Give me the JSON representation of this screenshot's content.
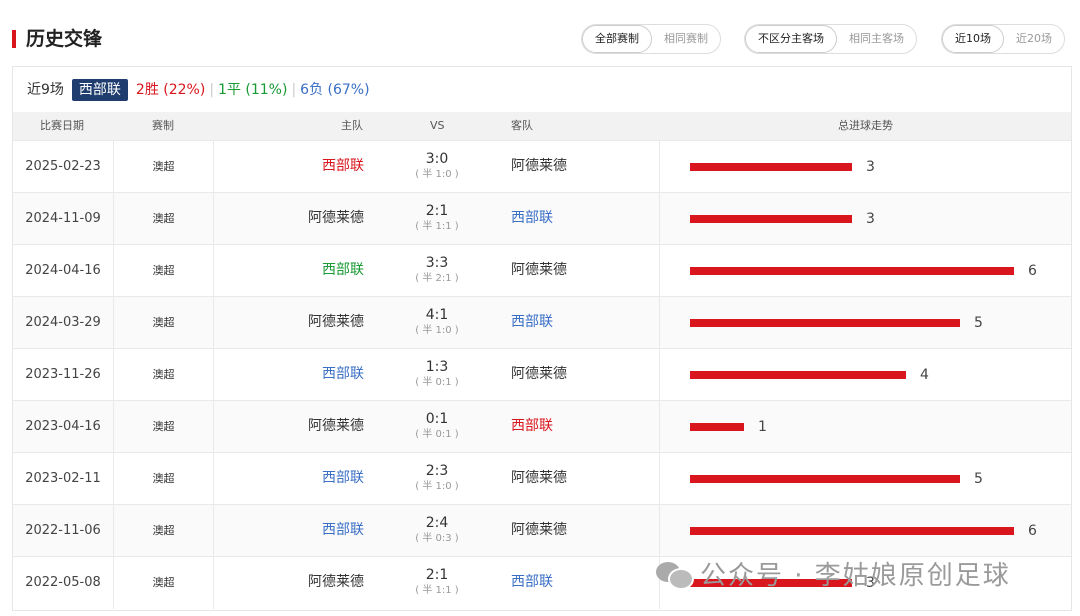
{
  "header": {
    "title": "历史交锋",
    "filter_groups": [
      {
        "options": [
          "全部赛制",
          "相同赛制"
        ],
        "selected": 0
      },
      {
        "options": [
          "不区分主客场",
          "相同主客场"
        ],
        "selected": 0
      },
      {
        "options": [
          "近10场",
          "近20场"
        ],
        "selected": 0
      }
    ]
  },
  "summary": {
    "recent_label": "近9场",
    "team": "西部联",
    "wins": "2胜 (22%)",
    "draws": "1平 (11%)",
    "losses": "6负 (67%)",
    "separator": "|"
  },
  "table": {
    "columns": [
      "比赛日期",
      "赛制",
      "主队",
      "VS",
      "客队",
      "总进球走势"
    ],
    "rows": [
      {
        "date": "2025-02-23",
        "competition": "澳超",
        "home": "西部联",
        "home_color": "#d9161e",
        "score": "3:0",
        "halftime": "( 半 1:0 )",
        "away": "阿德莱德",
        "away_color": "#333333",
        "total_goals": 3
      },
      {
        "date": "2024-11-09",
        "competition": "澳超",
        "home": "阿德莱德",
        "home_color": "#333333",
        "score": "2:1",
        "halftime": "( 半 1:1 )",
        "away": "西部联",
        "away_color": "#3a6fc5",
        "total_goals": 3
      },
      {
        "date": "2024-04-16",
        "competition": "澳超",
        "home": "西部联",
        "home_color": "#189a34",
        "score": "3:3",
        "halftime": "( 半 2:1 )",
        "away": "阿德莱德",
        "away_color": "#333333",
        "total_goals": 6
      },
      {
        "date": "2024-03-29",
        "competition": "澳超",
        "home": "阿德莱德",
        "home_color": "#333333",
        "score": "4:1",
        "halftime": "( 半 1:0 )",
        "away": "西部联",
        "away_color": "#3a6fc5",
        "total_goals": 5
      },
      {
        "date": "2023-11-26",
        "competition": "澳超",
        "home": "西部联",
        "home_color": "#3a6fc5",
        "score": "1:3",
        "halftime": "( 半 0:1 )",
        "away": "阿德莱德",
        "away_color": "#333333",
        "total_goals": 4
      },
      {
        "date": "2023-04-16",
        "competition": "澳超",
        "home": "阿德莱德",
        "home_color": "#333333",
        "score": "0:1",
        "halftime": "( 半 0:1 )",
        "away": "西部联",
        "away_color": "#d9161e",
        "total_goals": 1
      },
      {
        "date": "2023-02-11",
        "competition": "澳超",
        "home": "西部联",
        "home_color": "#3a6fc5",
        "score": "2:3",
        "halftime": "( 半 1:0 )",
        "away": "阿德莱德",
        "away_color": "#333333",
        "total_goals": 5
      },
      {
        "date": "2022-11-06",
        "competition": "澳超",
        "home": "西部联",
        "home_color": "#3a6fc5",
        "score": "2:4",
        "halftime": "( 半 0:3 )",
        "away": "阿德莱德",
        "away_color": "#333333",
        "total_goals": 6
      },
      {
        "date": "2022-05-08",
        "competition": "澳超",
        "home": "阿德莱德",
        "home_color": "#333333",
        "score": "2:1",
        "halftime": "( 半 1:1 )",
        "away": "西部联",
        "away_color": "#3a6fc5",
        "total_goals": 3
      }
    ]
  },
  "colors": {
    "accent": "#d9161e",
    "win": "#d9161e",
    "draw": "#189a34",
    "loss": "#3a6fc5",
    "team_badge": "#1f3d6f"
  },
  "watermark": {
    "icon": "wechat-icon",
    "text": "公众号 · 李姑娘原创足球"
  }
}
